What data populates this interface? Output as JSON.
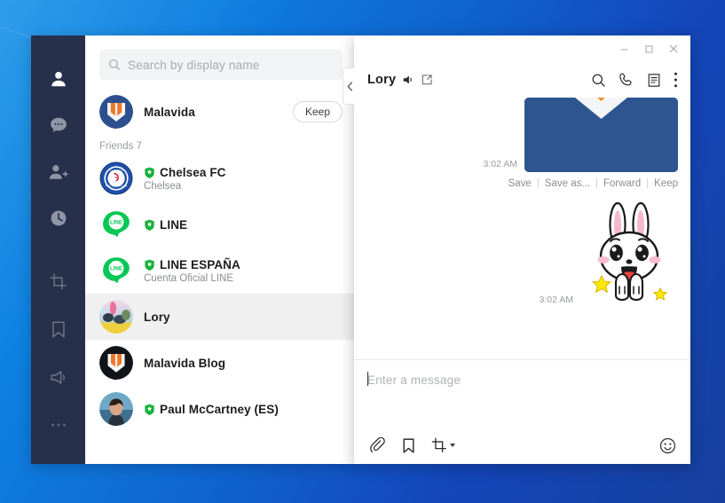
{
  "desktop": {
    "accent": "#0f63cf"
  },
  "app": {
    "rail": {
      "top_items": [
        {
          "name": "friends-icon",
          "label": "Friends",
          "active": true
        },
        {
          "name": "chats-icon",
          "label": "Chats",
          "active": false
        },
        {
          "name": "add-friends-icon",
          "label": "Add friends",
          "active": false
        },
        {
          "name": "timeline-icon",
          "label": "Timeline",
          "active": false
        }
      ],
      "bottom_items": [
        {
          "name": "screenshot-icon",
          "label": "Screen capture"
        },
        {
          "name": "keep-icon",
          "label": "Keep"
        },
        {
          "name": "announcements-icon",
          "label": "Announcements"
        },
        {
          "name": "more-icon",
          "label": "More"
        }
      ]
    },
    "search": {
      "placeholder": "Search by display name",
      "icon": "search-icon"
    },
    "profile": {
      "name": "Malavida",
      "keep_label": "Keep",
      "avatar": "malavida-logo"
    },
    "group_header": "Friends 7",
    "contacts": [
      {
        "name": "Chelsea FC",
        "sub": "Chelsea",
        "verified": true,
        "avatar": "chelsea-crest",
        "selected": false
      },
      {
        "name": "LINE",
        "sub": "",
        "verified": true,
        "avatar": "line-logo",
        "selected": false
      },
      {
        "name": "LINE ESPAÑA",
        "sub": "Cuenta Oficial LINE",
        "verified": true,
        "avatar": "line-logo",
        "selected": false
      },
      {
        "name": "Lory",
        "sub": "",
        "verified": false,
        "avatar": "lory-photo",
        "selected": true
      },
      {
        "name": "Malavida Blog",
        "sub": "",
        "verified": false,
        "avatar": "malavida-dark",
        "selected": false
      },
      {
        "name": "Paul McCartney (ES)",
        "sub": "",
        "verified": true,
        "avatar": "paul-photo",
        "selected": false
      }
    ],
    "collapse_tab": {
      "icon": "chevron-left-icon"
    }
  },
  "chat": {
    "window_controls": [
      {
        "name": "minimize-button",
        "glyph": "—"
      },
      {
        "name": "maximize-button",
        "glyph": "▢"
      },
      {
        "name": "close-button",
        "glyph": "✕"
      }
    ],
    "title": "Lory",
    "title_icons": [
      {
        "name": "mute-speaker-icon"
      },
      {
        "name": "popout-window-icon"
      }
    ],
    "header_actions": [
      {
        "name": "search-icon",
        "label": "Search"
      },
      {
        "name": "call-icon",
        "label": "Call"
      },
      {
        "name": "notes-icon",
        "label": "Notes"
      },
      {
        "name": "more-menu-icon",
        "label": "More"
      }
    ],
    "messages": [
      {
        "type": "image",
        "time": "3:02 AM",
        "actions": [
          "Save",
          "Save as...",
          "Forward",
          "Keep"
        ],
        "image_desc": "malavida-banner"
      },
      {
        "type": "sticker",
        "time": "3:02 AM",
        "image_desc": "cony-rabbit-sticker"
      }
    ],
    "composer": {
      "placeholder": "Enter a message",
      "tools": [
        {
          "name": "attach-file-icon",
          "label": "Attach file"
        },
        {
          "name": "keep-bookmark-icon",
          "label": "Keep"
        },
        {
          "name": "screen-capture-icon",
          "label": "Screen capture",
          "has_dropdown": true
        }
      ],
      "emoji": {
        "name": "emoji-icon",
        "label": "Stickers and emoji"
      }
    }
  }
}
